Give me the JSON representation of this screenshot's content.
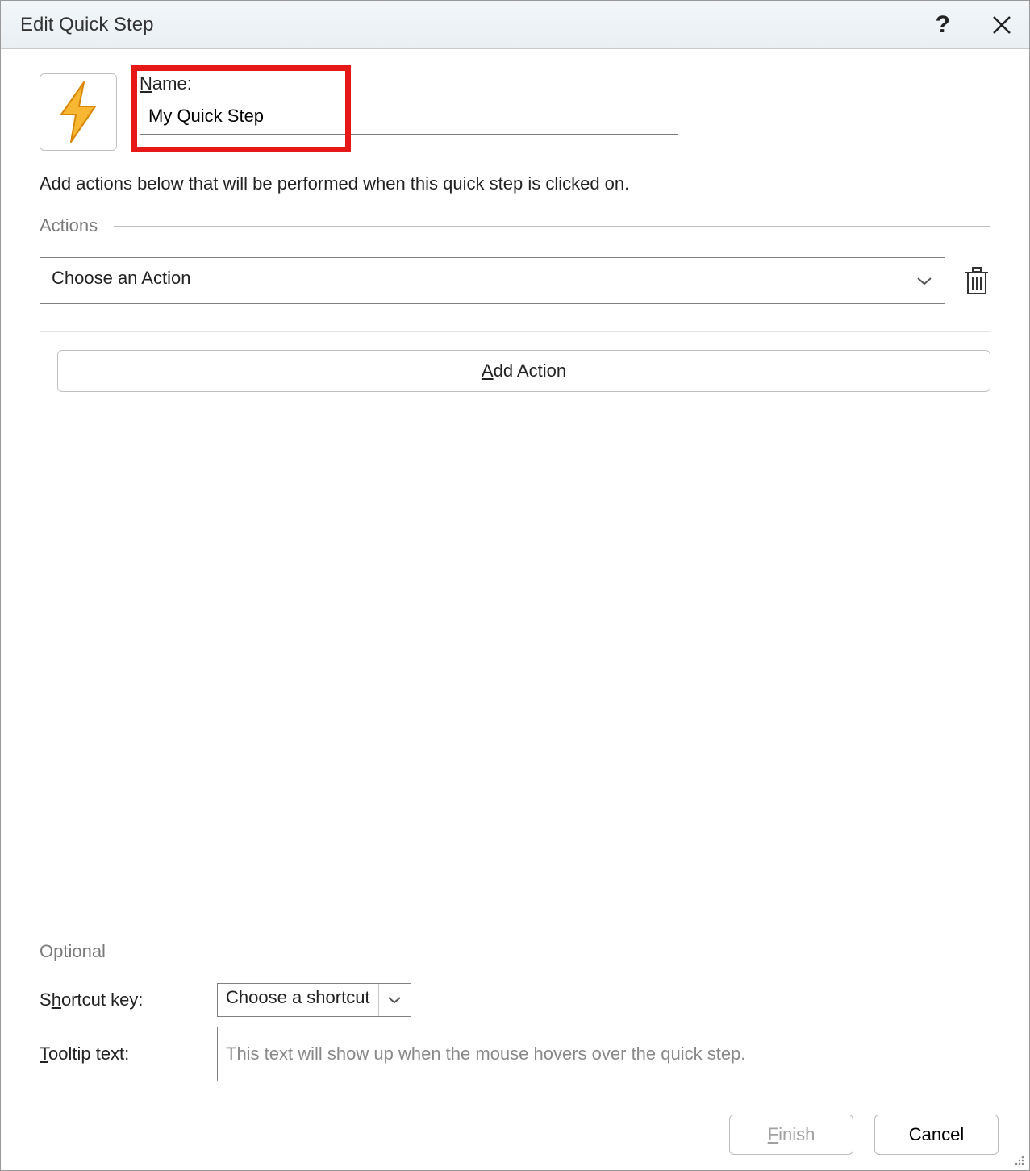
{
  "titlebar": {
    "title": "Edit Quick Step",
    "help": "?",
    "close": "✕"
  },
  "header": {
    "name_label": "Name:",
    "name_value": "My Quick Step",
    "icon_name": "lightning-bolt-icon"
  },
  "description": "Add actions below that will be performed when this quick step is clicked on.",
  "sections": {
    "actions_label": "Actions",
    "optional_label": "Optional"
  },
  "actions": {
    "choose_placeholder": "Choose an Action",
    "add_action_label": "Add Action",
    "add_action_hotkey": "A"
  },
  "optional": {
    "shortcut_label": "Shortcut key:",
    "shortcut_hotkey": "h",
    "shortcut_value": "Choose a shortcut",
    "tooltip_label": "Tooltip text:",
    "tooltip_hotkey": "T",
    "tooltip_placeholder": "This text will show up when the mouse hovers over the quick step."
  },
  "footer": {
    "finish_label": "Finish",
    "finish_hotkey": "F",
    "cancel_label": "Cancel"
  }
}
